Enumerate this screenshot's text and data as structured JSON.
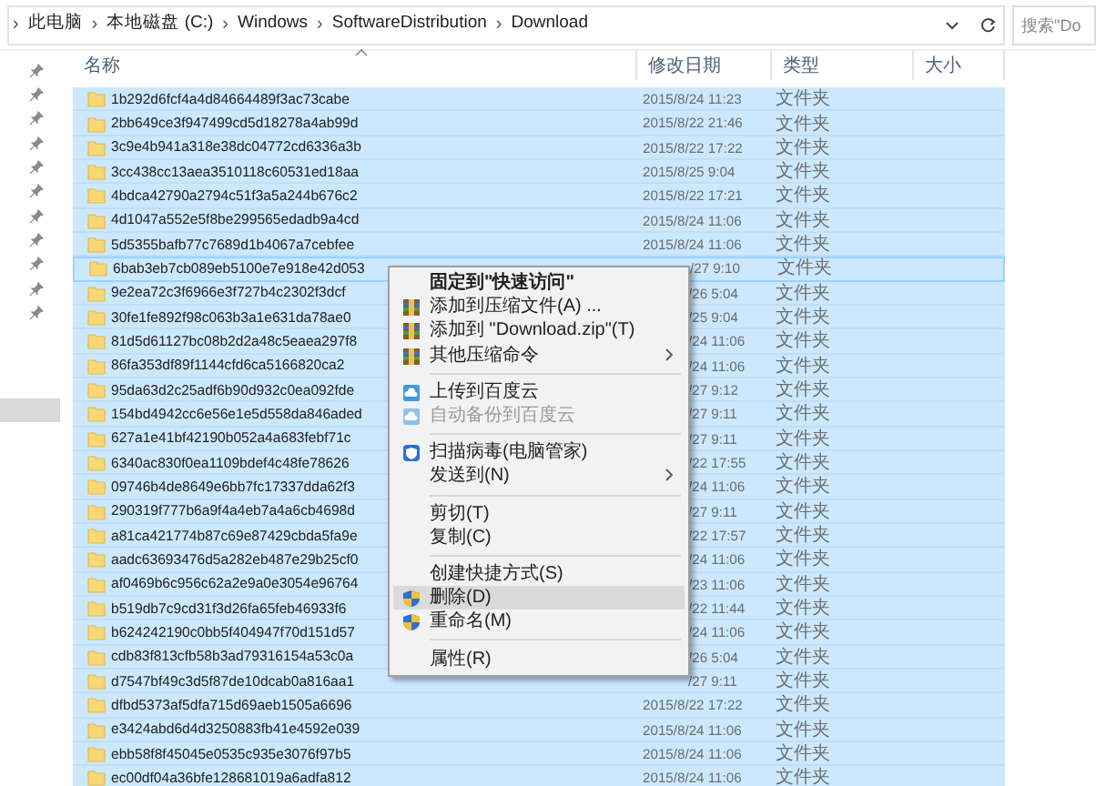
{
  "address_bar": {
    "crumbs": [
      {
        "kind": "sep",
        "text": "›"
      },
      {
        "kind": "crumb",
        "text": "此电脑"
      },
      {
        "kind": "sep",
        "text": "›"
      },
      {
        "kind": "crumb",
        "text": "本地磁盘 (C:)"
      },
      {
        "kind": "sep",
        "text": "›"
      },
      {
        "kind": "crumb",
        "text": "Windows"
      },
      {
        "kind": "sep",
        "text": "›"
      },
      {
        "kind": "crumb",
        "text": "SoftwareDistribution"
      },
      {
        "kind": "sep",
        "text": "›"
      },
      {
        "kind": "crumb",
        "text": "Download"
      }
    ]
  },
  "search": {
    "placeholder": "搜索\"Do"
  },
  "nav_pane": {
    "items": [
      {
        "pinned": true
      },
      {
        "pinned": true
      },
      {
        "pinned": true
      },
      {
        "pinned": true
      },
      {
        "pinned": true
      },
      {
        "pinned": true
      },
      {
        "pinned": true
      },
      {
        "pinned": true
      },
      {
        "pinned": true
      },
      {
        "pinned": true
      },
      {
        "pinned": true
      }
    ],
    "highlight": true
  },
  "table": {
    "columns": [
      {
        "label": "名称",
        "sorted": true
      },
      {
        "label": "修改日期",
        "sorted": false
      },
      {
        "label": "类型",
        "sorted": false
      },
      {
        "label": "大小",
        "sorted": false
      }
    ],
    "rows": [
      {
        "name": "1b292d6fcf4a4d84664489f3ac73cabe",
        "date": "2015/8/24 11:23",
        "date_cut": false,
        "type": "文件夹",
        "selected": true,
        "focused": false
      },
      {
        "name": "2bb649ce3f947499cd5d18278a4ab99d",
        "date": "2015/8/22 21:46",
        "date_cut": false,
        "type": "文件夹",
        "selected": true,
        "focused": false
      },
      {
        "name": "3c9e4b941a318e38dc04772cd6336a3b",
        "date": "2015/8/22 17:22",
        "date_cut": false,
        "type": "文件夹",
        "selected": true,
        "focused": false
      },
      {
        "name": "3cc438cc13aea3510118c60531ed18aa",
        "date": "2015/8/25 9:04",
        "date_cut": false,
        "type": "文件夹",
        "selected": true,
        "focused": false
      },
      {
        "name": "4bdca42790a2794c51f3a5a244b676c2",
        "date": "2015/8/22 17:21",
        "date_cut": false,
        "type": "文件夹",
        "selected": true,
        "focused": false
      },
      {
        "name": "4d1047a552e5f8be299565edadb9a4cd",
        "date": "2015/8/24 11:06",
        "date_cut": false,
        "type": "文件夹",
        "selected": true,
        "focused": false
      },
      {
        "name": "5d5355bafb77c7689d1b4067a7cebfee",
        "date": "2015/8/24 11:06",
        "date_cut": false,
        "type": "文件夹",
        "selected": true,
        "focused": false
      },
      {
        "name": "6bab3eb7cb089eb5100e7e918e42d053",
        "date": "/27 9:10",
        "date_cut": true,
        "type": "文件夹",
        "selected": true,
        "focused": true
      },
      {
        "name": "9e2ea72c3f6966e3f727b4c2302f3dcf",
        "date": "/26 5:04",
        "date_cut": true,
        "type": "文件夹",
        "selected": true,
        "focused": false
      },
      {
        "name": "30fe1fe892f98c063b3a1e631da78ae0",
        "date": "/25 9:04",
        "date_cut": true,
        "type": "文件夹",
        "selected": true,
        "focused": false
      },
      {
        "name": "81d5d61127bc08b2d2a48c5eaea297f8",
        "date": "/24 11:06",
        "date_cut": true,
        "type": "文件夹",
        "selected": true,
        "focused": false
      },
      {
        "name": "86fa353df89f1144cfd6ca5166820ca2",
        "date": "/24 11:06",
        "date_cut": true,
        "type": "文件夹",
        "selected": true,
        "focused": false
      },
      {
        "name": "95da63d2c25adf6b90d932c0ea092fde",
        "date": "/27 9:12",
        "date_cut": true,
        "type": "文件夹",
        "selected": true,
        "focused": false
      },
      {
        "name": "154bd4942cc6e56e1e5d558da846aded",
        "date": "/27 9:11",
        "date_cut": true,
        "type": "文件夹",
        "selected": true,
        "focused": false
      },
      {
        "name": "627a1e41bf42190b052a4a683febf71c",
        "date": "/27 9:11",
        "date_cut": true,
        "type": "文件夹",
        "selected": true,
        "focused": false
      },
      {
        "name": "6340ac830f0ea1109bdef4c48fe78626",
        "date": "/22 17:55",
        "date_cut": true,
        "type": "文件夹",
        "selected": true,
        "focused": false
      },
      {
        "name": "09746b4de8649e6bb7fc17337dda62f3",
        "date": "/24 11:06",
        "date_cut": true,
        "type": "文件夹",
        "selected": true,
        "focused": false
      },
      {
        "name": "290319f777b6a9f4a4eb7a4a6cb4698d",
        "date": "/27 9:11",
        "date_cut": true,
        "type": "文件夹",
        "selected": true,
        "focused": false
      },
      {
        "name": "a81ca421774b87c69e87429cbda5fa9e",
        "date": "/22 17:57",
        "date_cut": true,
        "type": "文件夹",
        "selected": true,
        "focused": false
      },
      {
        "name": "aadc63693476d5a282eb487e29b25cf0",
        "date": "/24 11:06",
        "date_cut": true,
        "type": "文件夹",
        "selected": true,
        "focused": false
      },
      {
        "name": "af0469b6c956c62a2e9a0e3054e96764",
        "date": "/23 11:06",
        "date_cut": true,
        "type": "文件夹",
        "selected": true,
        "focused": false
      },
      {
        "name": "b519db7c9cd31f3d26fa65feb46933f6",
        "date": "/22 11:44",
        "date_cut": true,
        "type": "文件夹",
        "selected": true,
        "focused": false
      },
      {
        "name": "b624242190c0bb5f404947f70d151d57",
        "date": "/24 11:06",
        "date_cut": true,
        "type": "文件夹",
        "selected": true,
        "focused": false
      },
      {
        "name": "cdb83f813cfb58b3ad79316154a53c0a",
        "date": "/26 5:04",
        "date_cut": true,
        "type": "文件夹",
        "selected": true,
        "focused": false
      },
      {
        "name": "d7547bf49c3d5f87de10dcab0a816aa1",
        "date": "/27 9:11",
        "date_cut": true,
        "type": "文件夹",
        "selected": true,
        "focused": false
      },
      {
        "name": "dfbd5373af5dfa715d69aeb1505a6696",
        "date": "2015/8/22 17:22",
        "date_cut": false,
        "type": "文件夹",
        "selected": true,
        "focused": false
      },
      {
        "name": "e3424abd6d4d3250883fb41e4592e039",
        "date": "2015/8/24 11:06",
        "date_cut": false,
        "type": "文件夹",
        "selected": true,
        "focused": false
      },
      {
        "name": "ebb58f8f45045e0535c935e3076f97b5",
        "date": "2015/8/24 11:06",
        "date_cut": false,
        "type": "文件夹",
        "selected": true,
        "focused": false
      },
      {
        "name": "ec00df04a36bfe128681019a6adfa812",
        "date": "2015/8/24 11:06",
        "date_cut": false,
        "type": "文件夹",
        "selected": true,
        "focused": false
      }
    ]
  },
  "context_menu": {
    "items": [
      {
        "kind": "plain",
        "label": "固定到\"快速访问\"",
        "default": true,
        "disabled": false,
        "highlighted": false,
        "submenu": false
      },
      {
        "kind": "archive",
        "label": "添加到压缩文件(A) ...",
        "default": false,
        "disabled": false,
        "highlighted": false,
        "submenu": false
      },
      {
        "kind": "archive",
        "label": "添加到 \"Download.zip\"(T)",
        "default": false,
        "disabled": false,
        "highlighted": false,
        "submenu": false
      },
      {
        "kind": "archive",
        "label": "其他压缩命令",
        "default": false,
        "disabled": false,
        "highlighted": false,
        "submenu": true
      },
      {
        "kind": "separator"
      },
      {
        "kind": "cloud",
        "label": "上传到百度云",
        "default": false,
        "disabled": false,
        "highlighted": false,
        "submenu": false
      },
      {
        "kind": "cloud",
        "label": "自动备份到百度云",
        "default": false,
        "disabled": true,
        "highlighted": false,
        "submenu": false
      },
      {
        "kind": "separator"
      },
      {
        "kind": "scan",
        "label": "扫描病毒(电脑管家)",
        "default": false,
        "disabled": false,
        "highlighted": false,
        "submenu": false
      },
      {
        "kind": "plain",
        "label": "发送到(N)",
        "default": false,
        "disabled": false,
        "highlighted": false,
        "submenu": true
      },
      {
        "kind": "separator"
      },
      {
        "kind": "plain",
        "label": "剪切(T)",
        "default": false,
        "disabled": false,
        "highlighted": false,
        "submenu": false
      },
      {
        "kind": "plain",
        "label": "复制(C)",
        "default": false,
        "disabled": false,
        "highlighted": false,
        "submenu": false
      },
      {
        "kind": "separator"
      },
      {
        "kind": "plain",
        "label": "创建快捷方式(S)",
        "default": false,
        "disabled": false,
        "highlighted": false,
        "submenu": false
      },
      {
        "kind": "uac",
        "label": "删除(D)",
        "default": false,
        "disabled": false,
        "highlighted": true,
        "submenu": false
      },
      {
        "kind": "uac",
        "label": "重命名(M)",
        "default": false,
        "disabled": false,
        "highlighted": false,
        "submenu": false
      },
      {
        "kind": "separator"
      },
      {
        "kind": "plain",
        "label": "属性(R)",
        "default": false,
        "disabled": false,
        "highlighted": false,
        "submenu": false
      }
    ]
  }
}
